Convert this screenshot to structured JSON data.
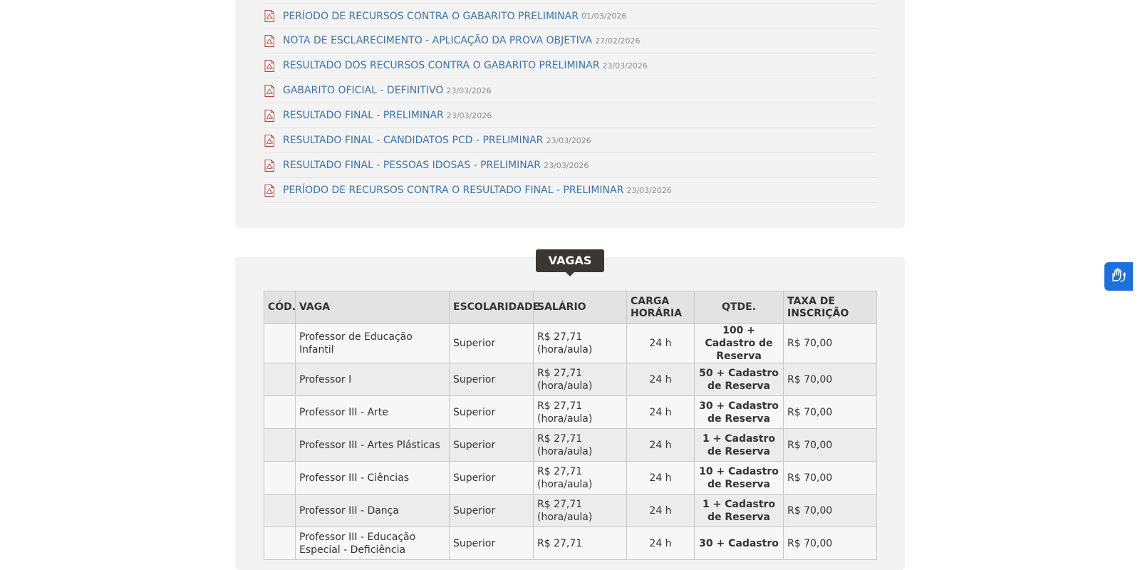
{
  "documents": [
    {
      "title": "PERÍODO DE RECURSOS CONTRA O GABARITO PRELIMINAR",
      "date": "01/03/2026"
    },
    {
      "title": "NOTA DE ESCLARECIMENTO - APLICAÇÃO DA PROVA OBJETIVA",
      "date": "27/02/2026"
    },
    {
      "title": "RESULTADO DOS RECURSOS CONTRA O GABARITO PRELIMINAR",
      "date": "23/03/2026"
    },
    {
      "title": "GABARITO OFICIAL - DEFINITIVO",
      "date": "23/03/2026"
    },
    {
      "title": "RESULTADO FINAL - PRELIMINAR",
      "date": "23/03/2026"
    },
    {
      "title": "RESULTADO FINAL - CANDIDATOS PCD - PRELIMINAR",
      "date": "23/03/2026"
    },
    {
      "title": "RESULTADO FINAL - PESSOAS IDOSAS - PRELIMINAR",
      "date": "23/03/2026"
    },
    {
      "title": "PERÍODO DE RECURSOS CONTRA O RESULTADO FINAL - PRELIMINAR",
      "date": "23/03/2026"
    }
  ],
  "vagas": {
    "heading": "VAGAS",
    "headers": {
      "cod": "CÓD.",
      "vaga": "VAGA",
      "escolaridade": "ESCOLARIDADE",
      "salario": "SALÁRIO",
      "carga": "CARGA HORÁRIA",
      "qtde": "QTDE.",
      "taxa": "TAXA DE INSCRIÇÃO"
    },
    "rows": [
      {
        "cod": "",
        "vaga": "Professor de Educação Infantil",
        "escolaridade": "Superior",
        "salario": "R$ 27,71 (hora/aula)",
        "carga": "24 h",
        "qtde": "100 + Cadastro de Reserva",
        "taxa": "R$ 70,00"
      },
      {
        "cod": "",
        "vaga": "Professor I",
        "escolaridade": "Superior",
        "salario": "R$ 27,71 (hora/aula)",
        "carga": "24 h",
        "qtde": "50 + Cadastro de Reserva",
        "taxa": "R$ 70,00"
      },
      {
        "cod": "",
        "vaga": "Professor III - Arte",
        "escolaridade": "Superior",
        "salario": "R$ 27,71 (hora/aula)",
        "carga": "24 h",
        "qtde": "30 + Cadastro de Reserva",
        "taxa": "R$ 70,00"
      },
      {
        "cod": "",
        "vaga": "Professor III - Artes Plásticas",
        "escolaridade": "Superior",
        "salario": "R$ 27,71 (hora/aula)",
        "carga": "24 h",
        "qtde": "1 + Cadastro de Reserva",
        "taxa": "R$ 70,00"
      },
      {
        "cod": "",
        "vaga": "Professor III - Ciências",
        "escolaridade": "Superior",
        "salario": "R$ 27,71 (hora/aula)",
        "carga": "24 h",
        "qtde": "10 + Cadastro de Reserva",
        "taxa": "R$ 70,00"
      },
      {
        "cod": "",
        "vaga": "Professor III - Dança",
        "escolaridade": "Superior",
        "salario": "R$ 27,71 (hora/aula)",
        "carga": "24 h",
        "qtde": "1 + Cadastro de Reserva",
        "taxa": "R$ 70,00"
      },
      {
        "cod": "",
        "vaga": "Professor III - Educação Especial - Deficiência",
        "escolaridade": "Superior",
        "salario": "R$ 27,71",
        "carga": "24 h",
        "qtde": "30 + Cadastro",
        "taxa": "R$ 70,00"
      }
    ]
  },
  "accessibility_widget": {
    "icon": "hands-sign-language-icon",
    "color": "#1d6fd9"
  }
}
